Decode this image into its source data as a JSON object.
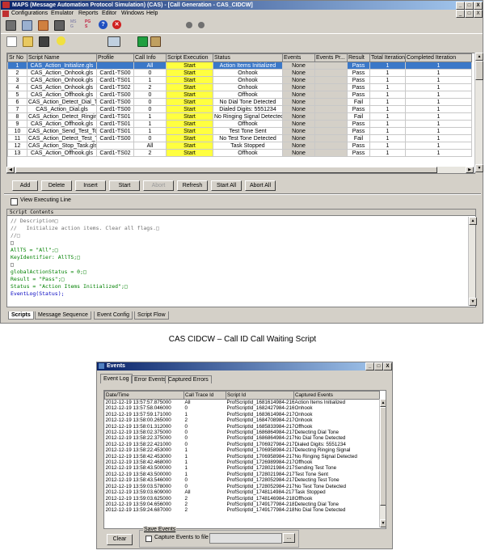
{
  "app": {
    "title": "MAPS (Message Automation Protocol Simulation)  (CAS) - [Call Generation - CAS_CIDCW]",
    "window_buttons": [
      "_",
      "□",
      "X"
    ],
    "inner_buttons": [
      "_",
      "□",
      "X"
    ]
  },
  "menu": [
    "Configurations",
    "Emulator",
    "Reports",
    "Editor",
    "Windows",
    "Help"
  ],
  "toolbar": {
    "icons": [
      "open-config-icon",
      "open-file-icon",
      "open-folder-icon",
      "save-icon",
      "lightbulb-icon",
      "monitor-icon",
      "bar-chart-icon",
      "network-icon",
      "record-icon",
      "stop-record-icon"
    ],
    "msg_label": "MS\nG",
    "pg_label": "PG\nS",
    "help": "?",
    "stop": "✕"
  },
  "grid": {
    "columns": [
      "Sr No",
      "Script Name",
      "Profile",
      "Call Info",
      "Script Execution",
      "Status",
      "Events",
      "Events Pr...",
      "Result",
      "Total Iterations",
      "Completed Iteration"
    ],
    "rows": [
      [
        "1",
        "CAS_Action_Initialize.gls",
        "",
        "All",
        "Start",
        "Action Items Initialized",
        "None",
        "",
        "Pass",
        "1",
        "1"
      ],
      [
        "2",
        "CAS_Action_Onhook.gls",
        "Card1-TS00",
        "0",
        "Start",
        "Onhook",
        "None",
        "",
        "Pass",
        "1",
        "1"
      ],
      [
        "3",
        "CAS_Action_Onhook.gls",
        "Card1-TS01",
        "1",
        "Start",
        "Onhook",
        "None",
        "",
        "Pass",
        "1",
        "1"
      ],
      [
        "4",
        "CAS_Action_Onhook.gls",
        "Card1-TS02",
        "2",
        "Start",
        "Onhook",
        "None",
        "",
        "Pass",
        "1",
        "1"
      ],
      [
        "5",
        "CAS_Action_Offhook.gls",
        "Card1-TS00",
        "0",
        "Start",
        "Offhook",
        "None",
        "",
        "Pass",
        "1",
        "1"
      ],
      [
        "6",
        "CAS_Action_Detect_Dial_Tone.gls",
        "Card1-TS00",
        "0",
        "Start",
        "No Dial Tone Detected",
        "None",
        "",
        "Fail",
        "1",
        "1"
      ],
      [
        "7",
        "CAS_Action_Dial.gls",
        "Card1-TS00",
        "0",
        "Start",
        "Dialed Digits: 5551234",
        "None",
        "",
        "Pass",
        "1",
        "1"
      ],
      [
        "8",
        "CAS_Action_Detect_Ringing_Signal...",
        "Card1-TS01",
        "1",
        "Start",
        "No Ringing Signal Detected",
        "None",
        "",
        "Fail",
        "1",
        "1"
      ],
      [
        "9",
        "CAS_Action_Offhook.gls",
        "Card1-TS01",
        "1",
        "Start",
        "Offhook",
        "None",
        "",
        "Pass",
        "1",
        "1"
      ],
      [
        "10",
        "CAS_Action_Send_Test_Tone.gls",
        "Card1-TS01",
        "1",
        "Start",
        "Test Tone Sent",
        "None",
        "",
        "Pass",
        "1",
        "1"
      ],
      [
        "11",
        "CAS_Action_Detect_Test_Tone.gls",
        "Card1-TS00",
        "0",
        "Start",
        "No Test Tone Detected",
        "None",
        "",
        "Fail",
        "1",
        "1"
      ],
      [
        "12",
        "CAS_Action_Stop_Task.gls",
        "",
        "All",
        "Start",
        "Task Stopped",
        "None",
        "",
        "Pass",
        "1",
        "1"
      ],
      [
        "13",
        "CAS_Action_Offhook.gls",
        "Card1-TS02",
        "2",
        "Start",
        "Offhook",
        "None",
        "",
        "Pass",
        "1",
        "1"
      ]
    ]
  },
  "buttons": [
    "Add",
    "Delete",
    "Insert",
    "Start",
    "Abort",
    "Refresh",
    "Start All",
    "Abort All"
  ],
  "view_executing_line": "View Executing Line",
  "script": {
    "header": "Script Contents",
    "lines": [
      "// Description□",
      "//   Initialize action items. Clear all flags.□",
      "//□",
      "□",
      "AllTS = \"All\";□",
      "KeyIdentifier: AllTS;□",
      "□",
      "globalActionStatus = 0;□",
      "Result = \"Pass\";□",
      "Status = \"Action Items Initialized\";□",
      "EventLog(Status);"
    ]
  },
  "bottom_tabs": [
    "Scripts",
    "Message Sequence",
    "Event Config",
    "Script Flow"
  ],
  "caption": "CAS CIDCW – Call ID Call Waiting Script",
  "events": {
    "title": "Events",
    "tabs": [
      "Event Log",
      "Error Events",
      "Captured Errors"
    ],
    "columns": [
      "Date/Time",
      "Call Trace Id",
      "Script Id",
      "Captured Events"
    ],
    "rows": [
      [
        "2012-12-19 13:57:57.875000",
        "All",
        "ProfScriptId_1681614984-2168",
        "Action Items Initialized"
      ],
      [
        "2012-12-19 13:57:58.046000",
        "0",
        "ProfScriptId_1682427984-2169",
        "Onhook"
      ],
      [
        "2012-12-19 13:57:59.171000",
        "1",
        "ProfScriptId_1683614984-2170",
        "Onhook"
      ],
      [
        "2012-12-19 13:58:00.265000",
        "2",
        "ProfScriptId_1684708984-2171",
        "Onhook"
      ],
      [
        "2012-12-19 13:58:01.312000",
        "0",
        "ProfScriptId_1685833984-2172",
        "Offhook"
      ],
      [
        "2012-12-19 13:58:02.375000",
        "0",
        "ProfScriptId_1686864984-2173",
        "Detecting Dial Tone"
      ],
      [
        "2012-12-19 13:58:22.375000",
        "0",
        "ProfScriptId_1686864984-2173",
        "No Dial Tone Detected"
      ],
      [
        "2012-12-19 13:58:22.421000",
        "0",
        "ProfScriptId_1706927984-2174",
        "Dialed Digits: 5551234"
      ],
      [
        "2012-12-19 13:58:22.453000",
        "1",
        "ProfScriptId_1706958984-2175",
        "Detecting Ringing Signal"
      ],
      [
        "2012-12-19 13:58:42.453000",
        "1",
        "ProfScriptId_1706958984-2175",
        "No Ringing Signal Detected"
      ],
      [
        "2012-12-19 13:58:42.468000",
        "1",
        "ProfScriptId_1726989984-2176",
        "Offhook"
      ],
      [
        "2012-12-19 13:58:43.500000",
        "1",
        "ProfScriptId_1728021984-2177",
        "Sending Test Tone"
      ],
      [
        "2012-12-19 13:58:43.500000",
        "1",
        "ProfScriptId_1728021984-2177",
        "Test Tone Sent"
      ],
      [
        "2012-12-19 13:58:43.546000",
        "0",
        "ProfScriptId_1728052984-2178",
        "Detecting Test Tone"
      ],
      [
        "2012-12-19 13:59:03.578000",
        "0",
        "ProfScriptId_1728052984-2178",
        "No Test Tone Detected"
      ],
      [
        "2012-12-19 13:59:03.609000",
        "All",
        "ProfScriptId_1748114984-2179",
        "Task Stopped"
      ],
      [
        "2012-12-19 13:59:03.625000",
        "2",
        "ProfScriptId_1748146984-2180",
        "Offhook"
      ],
      [
        "2012-12-19 13:59:04.656000",
        "2",
        "ProfScriptId_1749177984-2181",
        "Detecting Dial Tone"
      ],
      [
        "2012-12-19 13:59:24.687000",
        "2",
        "ProfScriptId_1749177984-2181",
        "No Dial Tone Detected"
      ]
    ],
    "clear": "Clear",
    "save_events": "Save Events",
    "capture_label": "Capture Events to file",
    "browse": "..."
  }
}
